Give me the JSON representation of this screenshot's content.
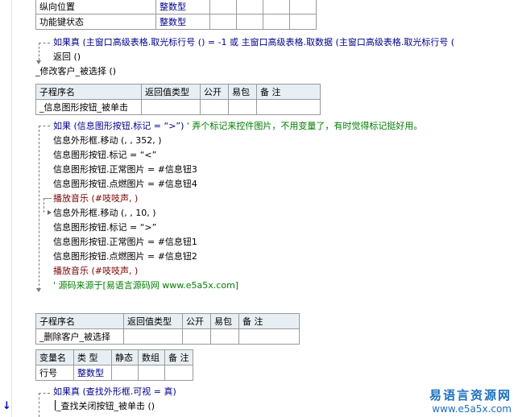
{
  "top_table": {
    "rows": [
      {
        "name": "纵向位置",
        "type": "整数型"
      },
      {
        "name": "功能键状态",
        "type": "整数型"
      }
    ]
  },
  "code1": {
    "if_line": "如果真 (主窗口高级表格.取光标行号 () = -1 或 主窗口高级表格.取数据 (主窗口高级表格.取光标行号 (",
    "return_line": "返回 ()",
    "call_line": "_修改客户_被选择 ()"
  },
  "sub_table1": {
    "headers": [
      "子程序名",
      "返回值类型",
      "公开",
      "易包",
      "备 注"
    ],
    "row": [
      "_信息图形按钮_被单击",
      "",
      "",
      "",
      ""
    ]
  },
  "code2": {
    "if_prefix": "如果 (信息图形按钮.标记 = “>”)",
    "if_comment": "' 弄个标记来控件图片，不用变量了，有时觉得标记挺好用。",
    "lines_a": [
      "信息外形框.移动 (, , 352, )",
      "信息图形按钮.标记 = “<”",
      "信息图形按钮.正常图片 = #信息钮3",
      "信息图形按钮.点燃图片 = #信息钮4",
      "播放音乐 (#吱吱声, )"
    ],
    "lines_b": [
      "信息外形框.移动 (, , 10, )",
      "信息图形按钮.标记 = “>”",
      "信息图形按钮.正常图片 = #信息钮1",
      "信息图形按钮.点燃图片 = #信息钮2",
      "播放音乐 (#吱吱声, )"
    ],
    "source_comment": "' 源码来源于[易语言源码网 www.e5a5x.com]"
  },
  "sub_table2": {
    "headers": [
      "子程序名",
      "返回值类型",
      "公开",
      "易包",
      "备 注"
    ],
    "row": [
      "_删除客户_被选择",
      "",
      "",
      "",
      ""
    ]
  },
  "var_table": {
    "headers": [
      "变量名",
      "类 型",
      "静态",
      "数组",
      "备 注"
    ],
    "row": [
      "行号",
      "整数型",
      "",
      "",
      ""
    ]
  },
  "code3": {
    "if_line": "如果真 (查找外形框.可视 = 真)",
    "call_line": "_查找关闭按钮_被单击 ()"
  },
  "watermark": {
    "title": "易语言资源网",
    "url": "www.e5a5x.com"
  },
  "colors": {
    "keyword": "#00008b",
    "comment": "#007d00",
    "table_header": "#e8eff4"
  }
}
